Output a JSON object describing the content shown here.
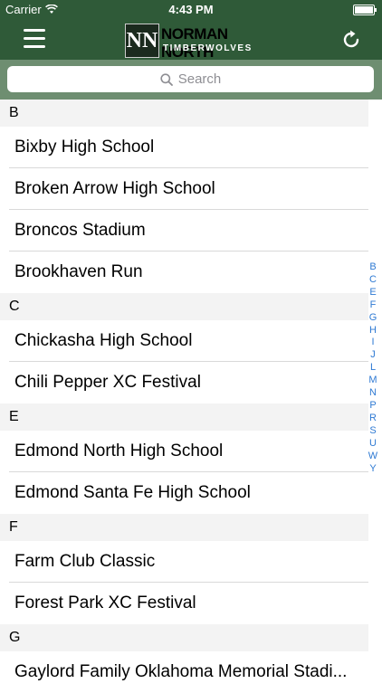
{
  "status": {
    "carrier": "Carrier",
    "time": "4:43 PM"
  },
  "nav": {
    "logo_title": "NORMAN NORTH",
    "logo_subtitle": "TIMBERWOLVES",
    "logo_mark": "NN"
  },
  "search": {
    "placeholder": "Search"
  },
  "sections": [
    {
      "letter": "B",
      "items": [
        "Bixby High School",
        "Broken Arrow High School",
        "Broncos Stadium",
        "Brookhaven Run"
      ]
    },
    {
      "letter": "C",
      "items": [
        "Chickasha High School",
        "Chili Pepper XC Festival"
      ]
    },
    {
      "letter": "E",
      "items": [
        "Edmond North High School",
        "Edmond Santa Fe High School"
      ]
    },
    {
      "letter": "F",
      "items": [
        "Farm Club Classic",
        "Forest Park XC Festival"
      ]
    },
    {
      "letter": "G",
      "items": [
        "Gaylord Family Oklahoma Memorial Stadi..."
      ]
    }
  ],
  "index_letters": [
    "B",
    "C",
    "E",
    "F",
    "G",
    "H",
    "I",
    "J",
    "L",
    "M",
    "N",
    "P",
    "R",
    "S",
    "U",
    "W",
    "Y"
  ],
  "colors": {
    "nav": "#2f5a38",
    "search_bar": "#6e8e71",
    "index": "#2f7ad3"
  }
}
